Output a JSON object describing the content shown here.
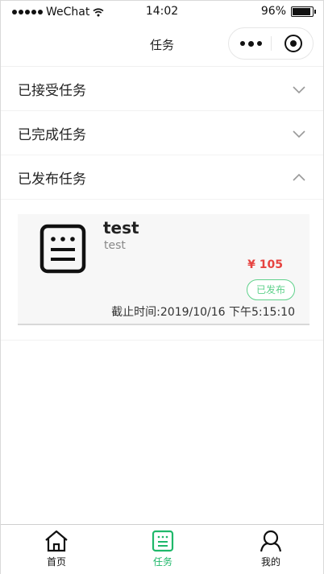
{
  "status_bar": {
    "carrier": "WeChat",
    "time": "14:02",
    "battery": "96%"
  },
  "nav": {
    "title": "任务"
  },
  "sections": [
    {
      "label": "已接受任务",
      "expanded": false
    },
    {
      "label": "已完成任务",
      "expanded": false
    },
    {
      "label": "已发布任务",
      "expanded": true
    }
  ],
  "task": {
    "title": "test",
    "description": "test",
    "price": "¥ 105",
    "status": "已发布",
    "deadline": "截止时间:2019/10/16 下午5:15:10",
    "icon": "task-list-icon"
  },
  "tabbar": {
    "items": [
      {
        "label": "首页",
        "icon": "home-icon",
        "active": false
      },
      {
        "label": "任务",
        "icon": "task-icon",
        "active": true
      },
      {
        "label": "我的",
        "icon": "profile-icon",
        "active": false
      }
    ],
    "active_color": "#1fb86a"
  },
  "colors": {
    "price": "#e64340",
    "status_badge": "#5fd18b",
    "accent": "#1fb86a"
  }
}
